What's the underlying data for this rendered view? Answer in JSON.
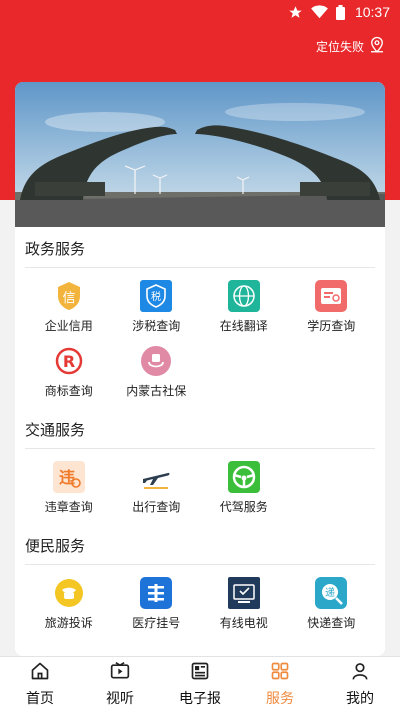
{
  "status_bar": {
    "time": "10:37"
  },
  "location": {
    "label": "定位失败"
  },
  "sections": [
    {
      "title": "政务服务",
      "items": [
        {
          "label": "企业信用",
          "icon": "enterprise-credit-icon",
          "color": "#f2b43c"
        },
        {
          "label": "涉税查询",
          "icon": "tax-query-icon",
          "color": "#1e88e5"
        },
        {
          "label": "在线翻译",
          "icon": "translate-icon",
          "color": "#1fb59a"
        },
        {
          "label": "学历查询",
          "icon": "education-query-icon",
          "color": "#f26b6b"
        },
        {
          "label": "商标查询",
          "icon": "trademark-icon",
          "color": "#e53935"
        },
        {
          "label": "内蒙古社保",
          "icon": "social-security-icon",
          "color": "#e08aa6"
        }
      ]
    },
    {
      "title": "交通服务",
      "items": [
        {
          "label": "违章查询",
          "icon": "violation-query-icon",
          "color": "#f07a2a"
        },
        {
          "label": "出行查询",
          "icon": "airplane-icon",
          "color": "#2c3e50"
        },
        {
          "label": "代驾服务",
          "icon": "steering-wheel-icon",
          "color": "#3bbf3b"
        }
      ]
    },
    {
      "title": "便民服务",
      "items": [
        {
          "label": "旅游投诉",
          "icon": "phone-complaint-icon",
          "color": "#f3c623"
        },
        {
          "label": "医疗挂号",
          "icon": "medical-register-icon",
          "color": "#1e73d8"
        },
        {
          "label": "有线电视",
          "icon": "cable-tv-icon",
          "color": "#1f3a5a"
        },
        {
          "label": "快递查询",
          "icon": "express-query-icon",
          "color": "#2aa7c9"
        }
      ]
    }
  ],
  "tabs": [
    {
      "label": "首页",
      "icon": "home-icon",
      "active": false
    },
    {
      "label": "视听",
      "icon": "video-icon",
      "active": false
    },
    {
      "label": "电子报",
      "icon": "newspaper-icon",
      "active": false
    },
    {
      "label": "服务",
      "icon": "services-grid-icon",
      "active": true
    },
    {
      "label": "我的",
      "icon": "profile-icon",
      "active": false
    }
  ]
}
